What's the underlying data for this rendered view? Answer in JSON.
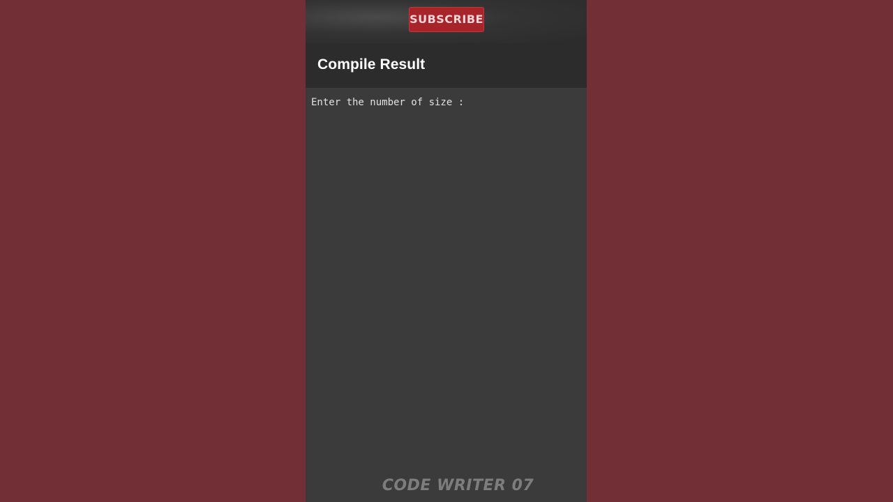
{
  "subscribe": {
    "label": "SUBSCRIBE"
  },
  "header": {
    "title": "Compile Result"
  },
  "console": {
    "prompt": "Enter the number of size :"
  },
  "watermark": {
    "text": "CODE WRITER 07"
  },
  "colors": {
    "background": "#722f35",
    "phone_bg": "#3a3a3a",
    "header_bg": "#2c2c2c",
    "subscribe_bg": "#a8242b"
  }
}
